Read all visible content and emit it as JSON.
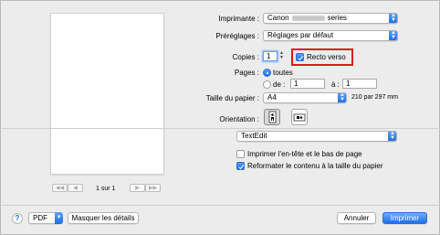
{
  "preview": {
    "page_counter": "1 sur 1",
    "nav_first": "◀◀",
    "nav_prev": "◀",
    "nav_next": "▶",
    "nav_last": "▶▶"
  },
  "printer": {
    "label": "Imprimante :",
    "value_prefix": "Canon",
    "value_suffix": "series"
  },
  "presets": {
    "label": "Préréglages :",
    "value": "Réglages par défaut"
  },
  "copies": {
    "label": "Copies :",
    "value": "1",
    "duplex_label": "Recto verso",
    "duplex_checked": true
  },
  "pages": {
    "label": "Pages :",
    "all_label": "toutes",
    "from_label": "de :",
    "from_value": "1",
    "to_label": "à :",
    "to_value": "1"
  },
  "paper_size": {
    "label": "Taille du papier :",
    "value": "A4",
    "dimensions": "210 par 297 mm"
  },
  "orientation": {
    "label": "Orientation :",
    "selected": "portrait"
  },
  "section_popup": {
    "value": "TextEdit"
  },
  "options": [
    {
      "label": "Imprimer l'en-tête et le bas de page",
      "checked": false
    },
    {
      "label": "Reformater le contenu à la taille du papier",
      "checked": true
    }
  ],
  "footer": {
    "help_label": "?",
    "pdf_label": "PDF",
    "details_label": "Masquer les détails",
    "cancel_label": "Annuler",
    "print_label": "Imprimer"
  },
  "colors": {
    "accent": "#1d6de6",
    "highlight": "#e0161d"
  }
}
